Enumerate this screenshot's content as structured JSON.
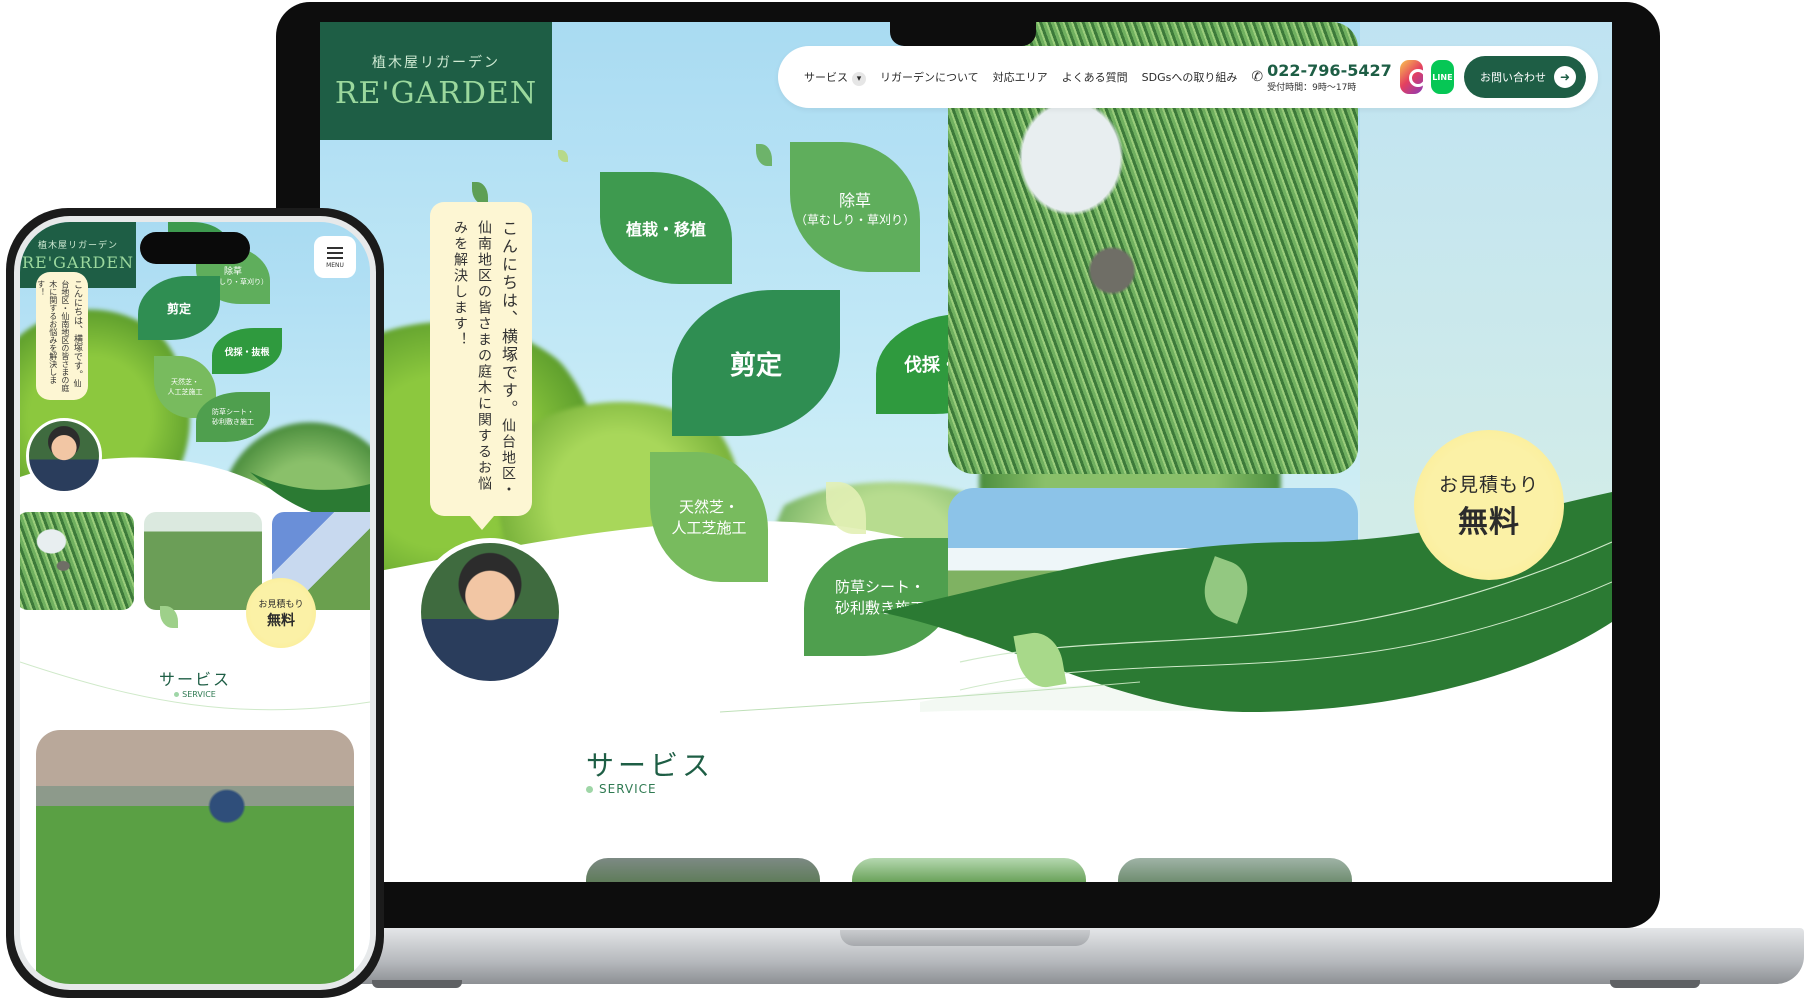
{
  "site": {
    "logo_sub": "植木屋リガーデン",
    "logo_main": "RE'GARDEN"
  },
  "nav": {
    "items": [
      "サービス",
      "リガーデンについて",
      "対応エリア",
      "よくある質問",
      "SDGsへの取り組み"
    ],
    "tel": "022-796-5427",
    "hours": "受付時間：9時〜17時",
    "line_label": "LINE",
    "contact_label": "お問い合わせ"
  },
  "hero": {
    "greeting": "こんにちは、横塚です。",
    "message": "仙台地区・仙南地区の皆さまの庭木に関するお悩みを解決します！",
    "leaves": {
      "planting": "植栽・移植",
      "weeding": "除草",
      "weeding_sub": "（草むしり・草刈り）",
      "pruning": "剪定",
      "felling": "伐採・抜根",
      "turf_1": "天然芝・",
      "turf_2": "人工芝施工",
      "sheet_1": "防草シート・",
      "sheet_2": "砂利敷き施工"
    },
    "estimate_top": "お見積もり",
    "estimate_bottom": "無料"
  },
  "services": {
    "title": "サービス",
    "subtitle": "SERVICE"
  },
  "mobile": {
    "menu_label": "MENU",
    "greeting": "こんにちは、横塚です。",
    "message": "仙台地区・仙南地区の皆さまの庭木に関するお悩みを解決します！",
    "leaves": {
      "weeding": "除草",
      "weeding_sub": "（草むしり・草刈り）",
      "pruning": "剪定",
      "felling": "伐採・抜根",
      "turf_1": "天然芝・",
      "turf_2": "人工芝施工",
      "sheet_1": "防草シート・",
      "sheet_2": "砂利敷き施工"
    },
    "estimate_top": "お見積もり",
    "estimate_bottom": "無料",
    "section_title": "サービス",
    "section_sub": "SERVICE"
  },
  "colors": {
    "brand_green": "#1e5e45",
    "leaf_green": "#3f9a50",
    "estimate_yellow": "#fbf1a6",
    "bubble_cream": "#fdf6d3"
  }
}
